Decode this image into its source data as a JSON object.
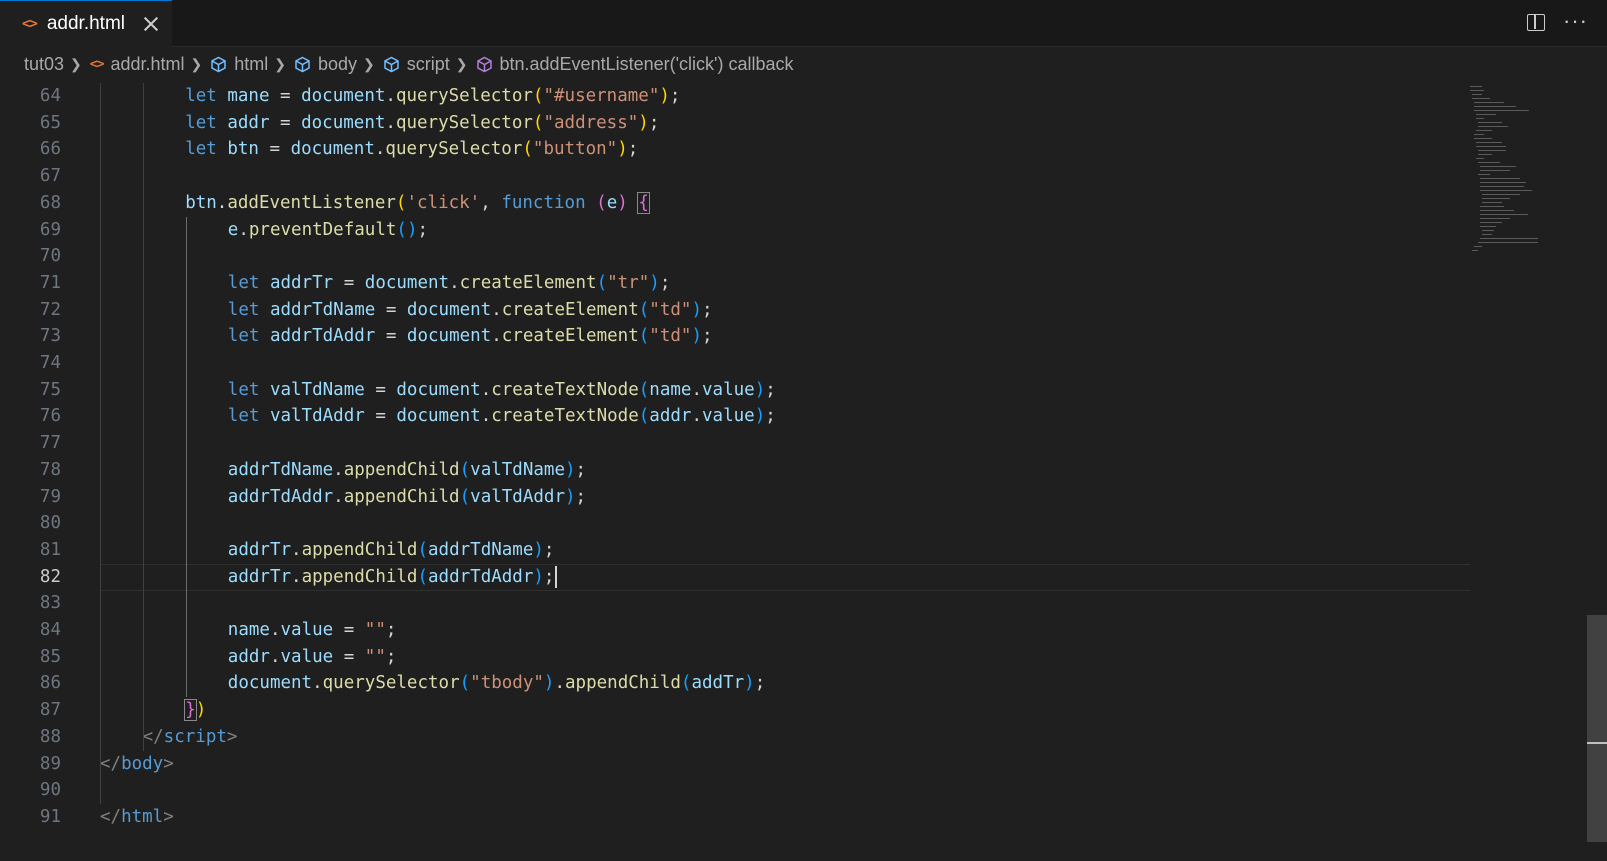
{
  "tab": {
    "label": "addr.html",
    "file_icon": "<>"
  },
  "breadcrumb": [
    {
      "label": "tut03",
      "icon": "folder"
    },
    {
      "label": "addr.html",
      "icon": "html-file-icon"
    },
    {
      "label": "html",
      "icon": "cube-icon"
    },
    {
      "label": "body",
      "icon": "cube-icon"
    },
    {
      "label": "script",
      "icon": "cube-icon"
    },
    {
      "label": "btn.addEventListener('click') callback",
      "icon": "method-icon"
    }
  ],
  "editor": {
    "current_line": 82,
    "lines": [
      {
        "n": "64",
        "indent": 2,
        "tokens": [
          [
            "kw",
            "let"
          ],
          [
            "pun",
            " "
          ],
          [
            "var",
            "mane"
          ],
          [
            "pun",
            " = "
          ],
          [
            "var",
            "document"
          ],
          [
            "pun",
            "."
          ],
          [
            "fn",
            "querySelector"
          ],
          [
            "b1",
            "("
          ],
          [
            "str",
            "\"#username\""
          ],
          [
            "b1",
            ")"
          ],
          [
            "pun",
            ";"
          ]
        ]
      },
      {
        "n": "65",
        "indent": 2,
        "tokens": [
          [
            "kw",
            "let"
          ],
          [
            "pun",
            " "
          ],
          [
            "var",
            "addr"
          ],
          [
            "pun",
            " = "
          ],
          [
            "var",
            "document"
          ],
          [
            "pun",
            "."
          ],
          [
            "fn",
            "querySelector"
          ],
          [
            "b1",
            "("
          ],
          [
            "str",
            "\"address\""
          ],
          [
            "b1",
            ")"
          ],
          [
            "pun",
            ";"
          ]
        ]
      },
      {
        "n": "66",
        "indent": 2,
        "tokens": [
          [
            "kw",
            "let"
          ],
          [
            "pun",
            " "
          ],
          [
            "var",
            "btn"
          ],
          [
            "pun",
            " = "
          ],
          [
            "var",
            "document"
          ],
          [
            "pun",
            "."
          ],
          [
            "fn",
            "querySelector"
          ],
          [
            "b1",
            "("
          ],
          [
            "str",
            "\"button\""
          ],
          [
            "b1",
            ")"
          ],
          [
            "pun",
            ";"
          ]
        ]
      },
      {
        "n": "67",
        "indent": 0,
        "tokens": []
      },
      {
        "n": "68",
        "indent": 2,
        "tokens": [
          [
            "var",
            "btn"
          ],
          [
            "pun",
            "."
          ],
          [
            "fn",
            "addEventListener"
          ],
          [
            "b1",
            "("
          ],
          [
            "str",
            "'click'"
          ],
          [
            "pun",
            ", "
          ],
          [
            "kw",
            "function"
          ],
          [
            "pun",
            " "
          ],
          [
            "b2",
            "("
          ],
          [
            "par",
            "e"
          ],
          [
            "b2",
            ")"
          ],
          [
            "pun",
            " "
          ],
          [
            "b2 bm",
            "{"
          ]
        ]
      },
      {
        "n": "69",
        "indent": 3,
        "tokens": [
          [
            "var",
            "e"
          ],
          [
            "pun",
            "."
          ],
          [
            "fn",
            "preventDefault"
          ],
          [
            "b3",
            "()"
          ],
          [
            "pun",
            ";"
          ]
        ]
      },
      {
        "n": "70",
        "indent": 0,
        "tokens": []
      },
      {
        "n": "71",
        "indent": 3,
        "tokens": [
          [
            "kw",
            "let"
          ],
          [
            "pun",
            " "
          ],
          [
            "var",
            "addrTr"
          ],
          [
            "pun",
            " = "
          ],
          [
            "var",
            "document"
          ],
          [
            "pun",
            "."
          ],
          [
            "fn",
            "createElement"
          ],
          [
            "b3",
            "("
          ],
          [
            "str",
            "\"tr\""
          ],
          [
            "b3",
            ")"
          ],
          [
            "pun",
            ";"
          ]
        ]
      },
      {
        "n": "72",
        "indent": 3,
        "tokens": [
          [
            "kw",
            "let"
          ],
          [
            "pun",
            " "
          ],
          [
            "var",
            "addrTdName"
          ],
          [
            "pun",
            " = "
          ],
          [
            "var",
            "document"
          ],
          [
            "pun",
            "."
          ],
          [
            "fn",
            "createElement"
          ],
          [
            "b3",
            "("
          ],
          [
            "str",
            "\"td\""
          ],
          [
            "b3",
            ")"
          ],
          [
            "pun",
            ";"
          ]
        ]
      },
      {
        "n": "73",
        "indent": 3,
        "tokens": [
          [
            "kw",
            "let"
          ],
          [
            "pun",
            " "
          ],
          [
            "var",
            "addrTdAddr"
          ],
          [
            "pun",
            " = "
          ],
          [
            "var",
            "document"
          ],
          [
            "pun",
            "."
          ],
          [
            "fn",
            "createElement"
          ],
          [
            "b3",
            "("
          ],
          [
            "str",
            "\"td\""
          ],
          [
            "b3",
            ")"
          ],
          [
            "pun",
            ";"
          ]
        ]
      },
      {
        "n": "74",
        "indent": 0,
        "tokens": []
      },
      {
        "n": "75",
        "indent": 3,
        "tokens": [
          [
            "kw",
            "let"
          ],
          [
            "pun",
            " "
          ],
          [
            "var",
            "valTdName"
          ],
          [
            "pun",
            " = "
          ],
          [
            "var",
            "document"
          ],
          [
            "pun",
            "."
          ],
          [
            "fn",
            "createTextNode"
          ],
          [
            "b3",
            "("
          ],
          [
            "var",
            "name"
          ],
          [
            "pun",
            "."
          ],
          [
            "var",
            "value"
          ],
          [
            "b3",
            ")"
          ],
          [
            "pun",
            ";"
          ]
        ]
      },
      {
        "n": "76",
        "indent": 3,
        "tokens": [
          [
            "kw",
            "let"
          ],
          [
            "pun",
            " "
          ],
          [
            "var",
            "valTdAddr"
          ],
          [
            "pun",
            " = "
          ],
          [
            "var",
            "document"
          ],
          [
            "pun",
            "."
          ],
          [
            "fn",
            "createTextNode"
          ],
          [
            "b3",
            "("
          ],
          [
            "var",
            "addr"
          ],
          [
            "pun",
            "."
          ],
          [
            "var",
            "value"
          ],
          [
            "b3",
            ")"
          ],
          [
            "pun",
            ";"
          ]
        ]
      },
      {
        "n": "77",
        "indent": 0,
        "tokens": []
      },
      {
        "n": "78",
        "indent": 3,
        "tokens": [
          [
            "var",
            "addrTdName"
          ],
          [
            "pun",
            "."
          ],
          [
            "fn",
            "appendChild"
          ],
          [
            "b3",
            "("
          ],
          [
            "var",
            "valTdName"
          ],
          [
            "b3",
            ")"
          ],
          [
            "pun",
            ";"
          ]
        ]
      },
      {
        "n": "79",
        "indent": 3,
        "tokens": [
          [
            "var",
            "addrTdAddr"
          ],
          [
            "pun",
            "."
          ],
          [
            "fn",
            "appendChild"
          ],
          [
            "b3",
            "("
          ],
          [
            "var",
            "valTdAddr"
          ],
          [
            "b3",
            ")"
          ],
          [
            "pun",
            ";"
          ]
        ]
      },
      {
        "n": "80",
        "indent": 0,
        "tokens": []
      },
      {
        "n": "81",
        "indent": 3,
        "tokens": [
          [
            "var",
            "addrTr"
          ],
          [
            "pun",
            "."
          ],
          [
            "fn",
            "appendChild"
          ],
          [
            "b3",
            "("
          ],
          [
            "var",
            "addrTdName"
          ],
          [
            "b3",
            ")"
          ],
          [
            "pun",
            ";"
          ]
        ]
      },
      {
        "n": "82",
        "indent": 3,
        "tokens": [
          [
            "var",
            "addrTr"
          ],
          [
            "pun",
            "."
          ],
          [
            "fn",
            "appendChild"
          ],
          [
            "b3",
            "("
          ],
          [
            "var",
            "addrTdAddr"
          ],
          [
            "b3",
            ")"
          ],
          [
            "pun",
            ";"
          ]
        ],
        "caret": true
      },
      {
        "n": "83",
        "indent": 0,
        "tokens": []
      },
      {
        "n": "84",
        "indent": 3,
        "tokens": [
          [
            "var",
            "name"
          ],
          [
            "pun",
            "."
          ],
          [
            "var",
            "value"
          ],
          [
            "pun",
            " = "
          ],
          [
            "str",
            "\"\""
          ],
          [
            "pun",
            ";"
          ]
        ]
      },
      {
        "n": "85",
        "indent": 3,
        "tokens": [
          [
            "var",
            "addr"
          ],
          [
            "pun",
            "."
          ],
          [
            "var",
            "value"
          ],
          [
            "pun",
            " = "
          ],
          [
            "str",
            "\"\""
          ],
          [
            "pun",
            ";"
          ]
        ]
      },
      {
        "n": "86",
        "indent": 3,
        "tokens": [
          [
            "var",
            "document"
          ],
          [
            "pun",
            "."
          ],
          [
            "fn",
            "querySelector"
          ],
          [
            "b3",
            "("
          ],
          [
            "str",
            "\"tbody\""
          ],
          [
            "b3",
            ")"
          ],
          [
            "pun",
            "."
          ],
          [
            "fn",
            "appendChild"
          ],
          [
            "b3",
            "("
          ],
          [
            "var",
            "addTr"
          ],
          [
            "b3",
            ")"
          ],
          [
            "pun",
            ";"
          ]
        ]
      },
      {
        "n": "87",
        "indent": 2,
        "tokens": [
          [
            "b2 bm",
            "}"
          ],
          [
            "b1",
            ")"
          ]
        ]
      },
      {
        "n": "88",
        "indent": 1,
        "tokens": [
          [
            "tagp",
            "</"
          ],
          [
            "tag",
            "script"
          ],
          [
            "tagp",
            ">"
          ]
        ]
      },
      {
        "n": "89",
        "indent": 0,
        "tokens": [
          [
            "tagp",
            "</"
          ],
          [
            "tag",
            "body"
          ],
          [
            "tagp",
            ">"
          ]
        ]
      },
      {
        "n": "90",
        "indent": 0,
        "tokens": []
      },
      {
        "n": "91",
        "indent": 0,
        "tokens": [
          [
            "tagp",
            "</"
          ],
          [
            "tag",
            "html"
          ],
          [
            "tagp",
            ">"
          ]
        ]
      }
    ]
  },
  "icons": {
    "split": "split-editor-icon",
    "more": "more-actions-icon",
    "close": "close-icon"
  }
}
